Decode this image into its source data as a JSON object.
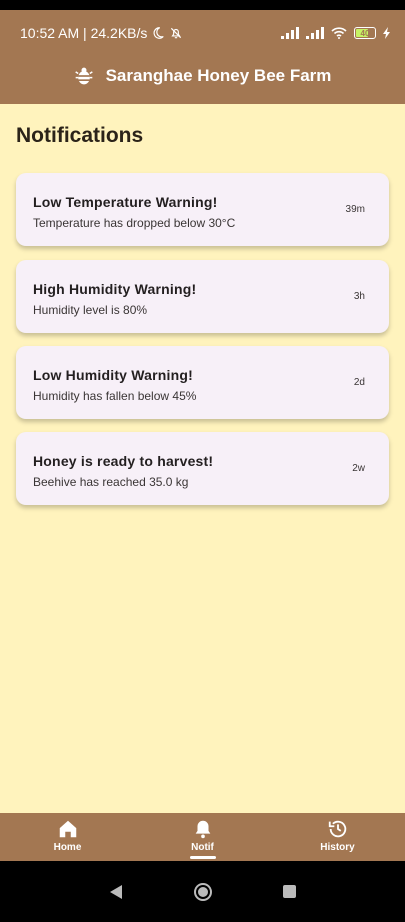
{
  "status_bar": {
    "time_speed": "10:52 AM | 24.2KB/s",
    "battery": "40"
  },
  "app_bar": {
    "title": "Saranghae Honey Bee Farm",
    "icon": "bee-icon"
  },
  "page": {
    "title": "Notifications"
  },
  "notifications": [
    {
      "title": "Low Temperature Warning!",
      "subtitle": "Temperature has dropped below 30°C",
      "time": "39m"
    },
    {
      "title": "High Humidity Warning!",
      "subtitle": "Humidity level is 80%",
      "time": "3h"
    },
    {
      "title": "Low Humidity Warning!",
      "subtitle": "Humidity has fallen below 45%",
      "time": "2d"
    },
    {
      "title": "Honey is ready to harvest!",
      "subtitle": "Beehive has reached 35.0 kg",
      "time": "2w"
    }
  ],
  "bottom_nav": {
    "items": [
      {
        "label": "Home",
        "icon": "home-icon"
      },
      {
        "label": "Notif",
        "icon": "bell-icon",
        "active": true
      },
      {
        "label": "History",
        "icon": "history-icon"
      }
    ]
  },
  "colors": {
    "primary": "#A37752",
    "background": "#FFF3BD",
    "card": "#F7F0F8"
  }
}
